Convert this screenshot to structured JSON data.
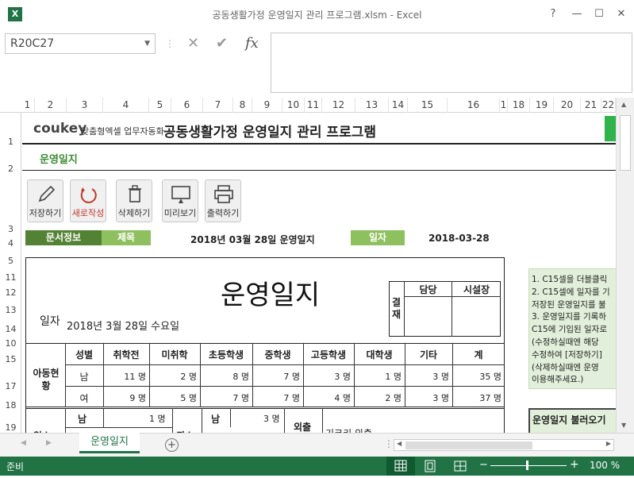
{
  "window": {
    "title": "공동생활가정 운영일지 관리 프로그램.xlsm - Excel",
    "app_icon": "X"
  },
  "formula_bar": {
    "name_box": "R20C27",
    "fx": "fx"
  },
  "columns": [
    "1",
    "2",
    "3",
    "4",
    "5",
    "6",
    "7",
    "8",
    "9",
    "10",
    "11",
    "12",
    "13",
    "14",
    "15",
    "16",
    "1",
    "18",
    "19",
    "20",
    "21",
    "22"
  ],
  "rows": [
    "1",
    "2",
    "3",
    "4",
    "5",
    "11",
    "12",
    "13",
    "14",
    "10",
    "15",
    "17",
    "18",
    "19",
    "20"
  ],
  "header": {
    "logo_brand": "coukey",
    "logo_tagline": "맞춤형엑셀 업무자동화",
    "program_title": "공동생활가정 운영일지 관리 프로그램",
    "section_title": "운영일지"
  },
  "toolbar": [
    {
      "label": "저장하기",
      "icon": "pencil-icon"
    },
    {
      "label": "새로작성",
      "icon": "refresh-icon"
    },
    {
      "label": "삭제하기",
      "icon": "trash-icon"
    },
    {
      "label": "미리보기",
      "icon": "monitor-icon"
    },
    {
      "label": "출력하기",
      "icon": "printer-icon"
    }
  ],
  "info_bar": {
    "doc_info": "문서정보",
    "subject_label": "제목",
    "subject_value": "2018년 03월 28일 운영일지",
    "date_label": "일자",
    "date_value": "2018-03-28"
  },
  "form": {
    "title": "운영일지",
    "date_label": "일자",
    "date_value": "2018년  3월  28일  수요일",
    "approval": {
      "label": "결재",
      "col1": "담당",
      "col2": "시설장"
    },
    "kids_label": "아동현황",
    "columns": [
      "성별",
      "취학전",
      "미취학",
      "초등학생",
      "중학생",
      "고등학생",
      "대학생",
      "기타",
      "계"
    ],
    "rows": [
      {
        "gender": "남",
        "values": [
          "11 명",
          "2 명",
          "8 명",
          "7 명",
          "3 명",
          "1 명",
          "3 명",
          "35 명"
        ]
      },
      {
        "gender": "여",
        "values": [
          "9 명",
          "5 명",
          "7 명",
          "7 명",
          "4 명",
          "2 명",
          "3 명",
          "37 명"
        ]
      }
    ],
    "bottom": {
      "left_label": "입소",
      "male": "남",
      "male_count": "1 명",
      "mid_label": "퇴소",
      "mid_male": "남",
      "mid_male_count": "3 명",
      "outing": "외출",
      "outing_text": "기크키 외출"
    }
  },
  "notes": {
    "lines": [
      "1. C15셀을 더블클릭",
      "2. C15셀에 일자를 기",
      "저장된 운영일지를 불",
      "3. 운영일지를 기록하",
      "C15에 기입된 일자로",
      "(수정하실때엔 해당",
      "수정하여 [저장하기]",
      "(삭제하실때엔 운영",
      "이용해주세요.)"
    ],
    "load_button": "운영일지 불러오기"
  },
  "sheet_tabs": {
    "active": "운영일지",
    "add": "+"
  },
  "status": {
    "ready": "준비",
    "zoom": "100 %"
  },
  "colors": {
    "excel_green": "#217346",
    "accent_green": "#70ad47",
    "dark_green": "#548235",
    "light_green": "#e2efda"
  }
}
